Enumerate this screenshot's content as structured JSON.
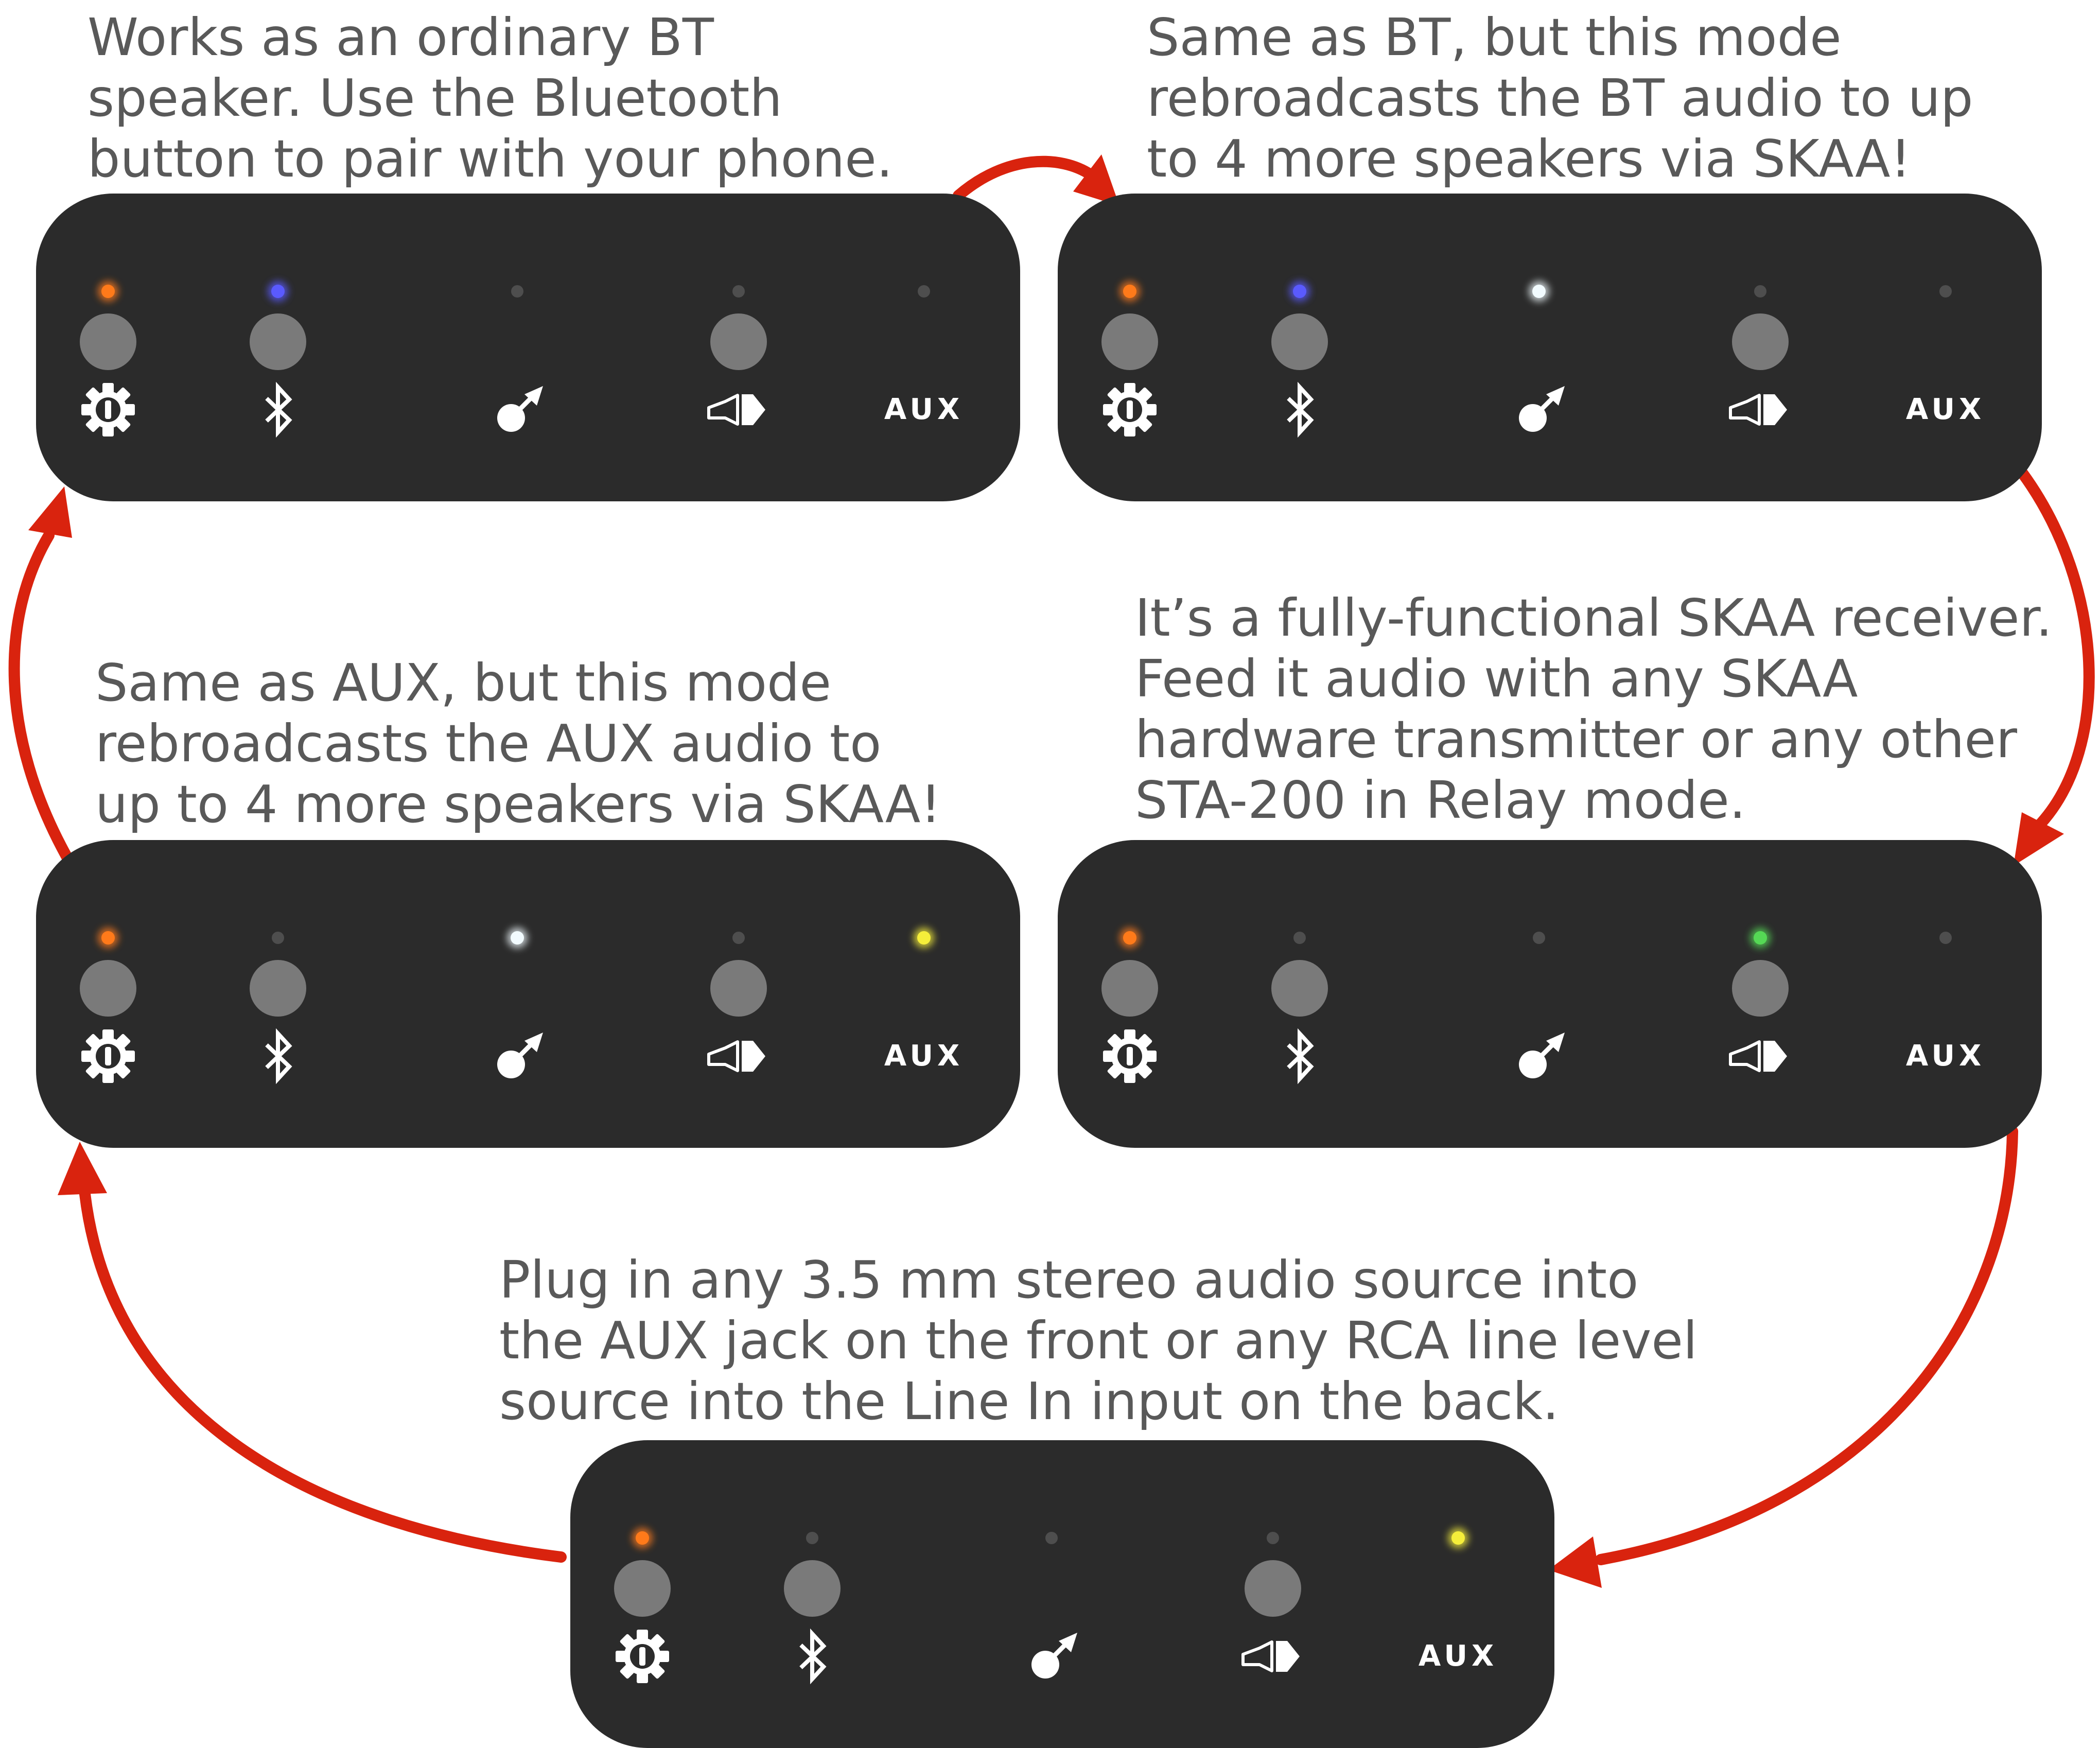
{
  "colors": {
    "panel": "#2b2b2b",
    "button": "#7a7a7a",
    "icon": "#ffffff",
    "text": "#595959",
    "arrow": "#d9230e",
    "led_off": "#4e4e4e",
    "led_orange": "#ff7a1a",
    "led_blue": "#5a5aff",
    "led_white": "#f2fbff",
    "led_green": "#55d855",
    "led_yellow": "#f5ee3a"
  },
  "aux_label": "AUX",
  "column_icons": [
    "power-icon",
    "bluetooth-icon",
    "relay-icon",
    "speaker-icon",
    "aux-label"
  ],
  "modes": [
    {
      "id": "bt",
      "caption": [
        "Works as an ordinary BT",
        "speaker. Use the Bluetooth",
        "button to pair with your phone."
      ],
      "leds": [
        "orange",
        "blue",
        "off",
        "off",
        "off"
      ]
    },
    {
      "id": "bt-relay",
      "caption": [
        "Same as BT, but this mode",
        "rebroadcasts the BT audio to up",
        "to 4 more speakers via SKAA!"
      ],
      "leds": [
        "orange",
        "blue",
        "white",
        "off",
        "off"
      ]
    },
    {
      "id": "skaa-receiver",
      "caption": [
        "It’s a fully-functional SKAA receiver.",
        "Feed it audio with any SKAA",
        "hardware transmitter or any other",
        "STA-200 in Relay mode."
      ],
      "leds": [
        "orange",
        "off",
        "off",
        "green",
        "off"
      ]
    },
    {
      "id": "aux",
      "caption": [
        "Plug in any 3.5 mm stereo audio source into",
        "the AUX jack on the front or any RCA line level",
        "source into the Line In input on the back."
      ],
      "leds": [
        "orange",
        "off",
        "off",
        "off",
        "yellow"
      ]
    },
    {
      "id": "aux-relay",
      "caption": [
        "Same as AUX, but this mode",
        "rebroadcasts the AUX audio to",
        "up to 4 more speakers via SKAA!"
      ],
      "leds": [
        "orange",
        "off",
        "white",
        "off",
        "yellow"
      ]
    }
  ]
}
